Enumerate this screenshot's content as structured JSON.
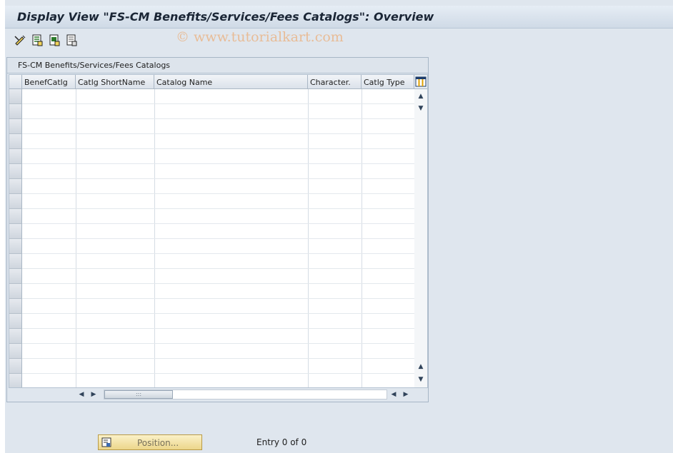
{
  "window": {
    "title": "Display View \"FS-CM Benefits/Services/Fees Catalogs\": Overview"
  },
  "watermark": "© www.tutorialkart.com",
  "toolbar": {
    "buttons": [
      {
        "icon": "display-change-icon"
      },
      {
        "icon": "select-all-icon"
      },
      {
        "icon": "select-block-icon"
      },
      {
        "icon": "deselect-all-icon"
      }
    ]
  },
  "table": {
    "title": "FS-CM Benefits/Services/Fees Catalogs",
    "columns": [
      {
        "label": "BenefCatlg"
      },
      {
        "label": "Catlg ShortName"
      },
      {
        "label": "Catalog Name"
      },
      {
        "label": "Character."
      },
      {
        "label": "Catlg Type"
      }
    ],
    "rows": []
  },
  "footer": {
    "position_label": "Position...",
    "entry_text": "Entry 0 of 0"
  },
  "colors": {
    "background": "#dfe6ee",
    "title": "#1a2535",
    "watermark": "#e9b88e",
    "button_yellow": "#ecd68a"
  }
}
